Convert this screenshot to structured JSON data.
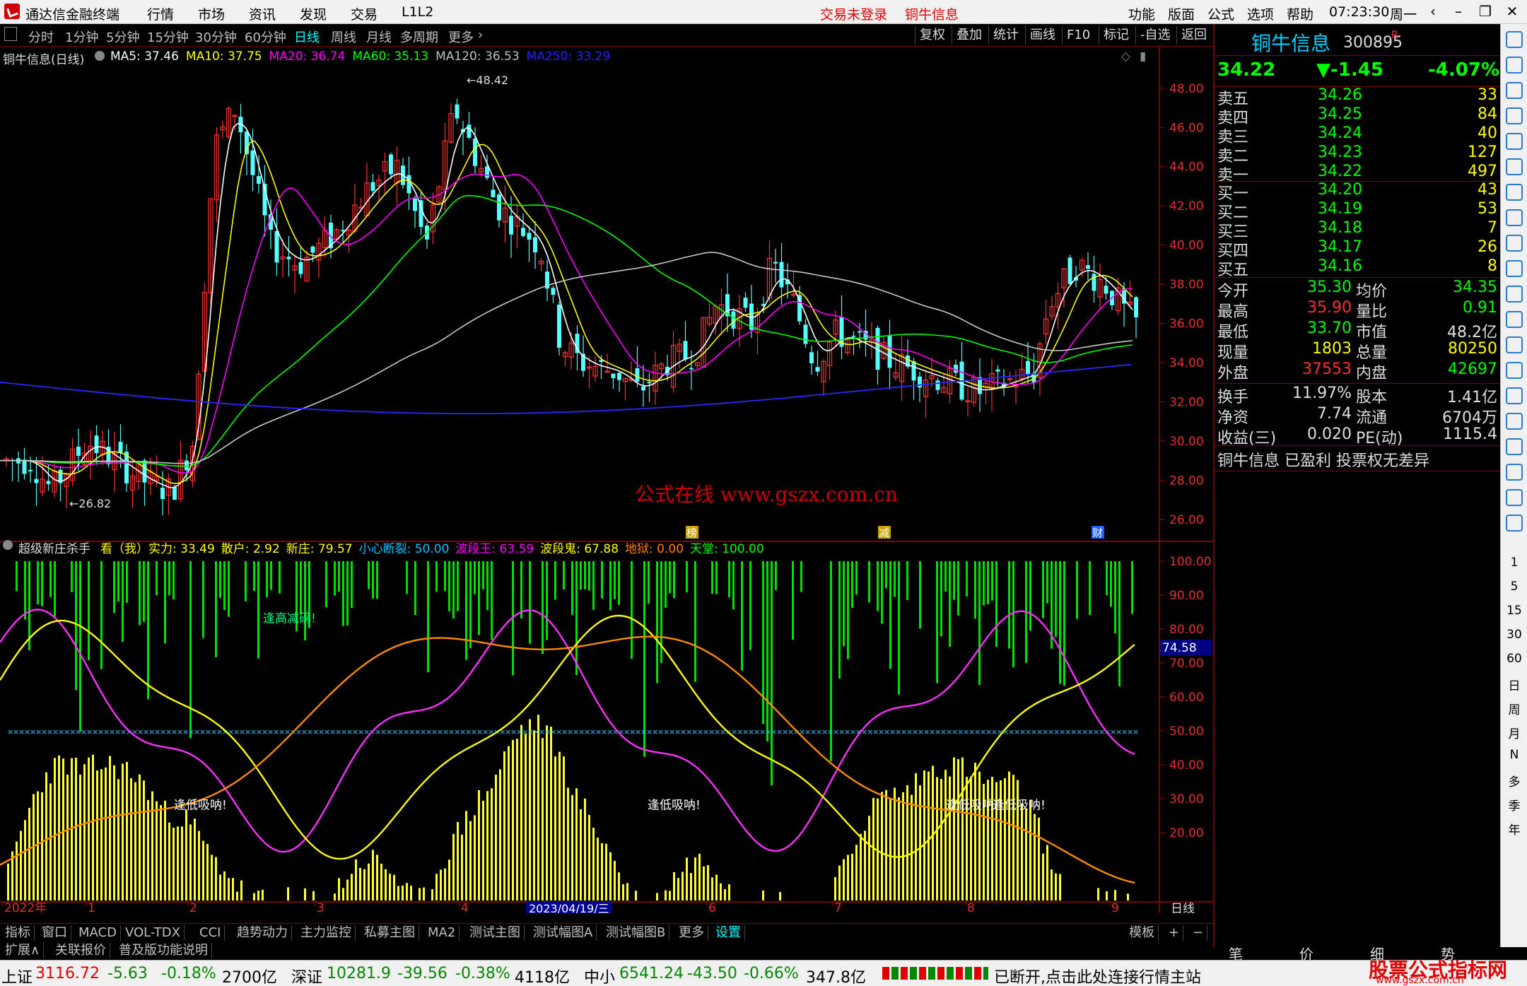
{
  "titlebar": {
    "app_title": "通达信金融终端",
    "menus": [
      "行情",
      "市场",
      "资讯",
      "发现",
      "交易",
      "L1L2"
    ],
    "login_status": "交易未登录",
    "stock_tag": "铜牛信息",
    "right_menus": [
      "功能",
      "版面",
      "公式",
      "选项",
      "帮助"
    ],
    "clock": "07:23:30",
    "weekday": "周一"
  },
  "toolbar": {
    "periods": [
      "分时",
      "1分钟",
      "5分钟",
      "15分钟",
      "30分钟",
      "60分钟",
      "日线",
      "周线",
      "月线",
      "多周期",
      "更多"
    ],
    "active_period": "日线",
    "right_buttons": [
      "复权",
      "叠加",
      "统计",
      "画线",
      "F10",
      "标记",
      "-自选",
      "返回"
    ]
  },
  "main_chart": {
    "title": "铜牛信息(日线)",
    "ma": [
      {
        "label": "MA5: 37.46",
        "color": "#ffffff"
      },
      {
        "label": "MA10: 37.75",
        "color": "#ffff00"
      },
      {
        "label": "MA20: 36.74",
        "color": "#ff00ff"
      },
      {
        "label": "MA60: 35.13",
        "color": "#00ff00"
      },
      {
        "label": "MA120: 36.53",
        "color": "#c0c0c0"
      },
      {
        "label": "MA250: 33.29",
        "color": "#2020ff"
      }
    ],
    "y_ticks": [
      "48.00",
      "46.00",
      "44.00",
      "42.00",
      "40.00",
      "38.00",
      "36.00",
      "34.00",
      "32.00",
      "30.00",
      "28.00",
      "26.00"
    ],
    "high_mark": "48.42",
    "low_mark": "26.82",
    "watermark": "公式在线  www.gszx.com.cn",
    "event_markers": [
      "榜",
      "减",
      "财"
    ]
  },
  "indicator": {
    "name": "超级新庄杀手",
    "labels": [
      {
        "text": "看（我）实力: 33.49",
        "color": "#ffff00"
      },
      {
        "text": "散户: 2.92",
        "color": "#ffff00"
      },
      {
        "text": "新庄: 79.57",
        "color": "#ffff00"
      },
      {
        "text": "小心断裂: 50.00",
        "color": "#00c0ff"
      },
      {
        "text": "波段王: 63.59",
        "color": "#ff00ff"
      },
      {
        "text": "波段鬼: 67.88",
        "color": "#ffff00"
      },
      {
        "text": "地狱: 0.00",
        "color": "#ff8000"
      },
      {
        "text": "天堂: 100.00",
        "color": "#00ff00"
      }
    ],
    "y_ticks": [
      "100.00",
      "90.00",
      "80.00",
      "70.00",
      "60.00",
      "50.00",
      "40.00",
      "30.00",
      "20.00"
    ],
    "current_value": "74.58",
    "annotations": [
      "逢高减磅!",
      "逢低吸呐!",
      "逢低吸呐!",
      "逢低吸呐!",
      "逢低吸呐!"
    ]
  },
  "x_axis": {
    "labels": [
      "2022年",
      "1",
      "2",
      "3",
      "4",
      "5",
      "6",
      "7",
      "8",
      "9"
    ],
    "cursor_date": "2023/04/19/三",
    "period": "日线"
  },
  "tabs_row1": [
    "指标",
    "窗口",
    "MACD",
    "VOL-TDX",
    "CCI",
    "趋势动力",
    "主力监控",
    "私募主图",
    "MA2",
    "测试主图",
    "测试幅图A",
    "测试幅图B",
    "更多",
    "设置"
  ],
  "tabs_row1_right": [
    "模板",
    "+",
    "−"
  ],
  "tabs_row2": [
    "扩展∧",
    "关联报价",
    "普及版功能说明"
  ],
  "quote_panel": {
    "name": "铜牛信息",
    "code": "300895",
    "tag": "R",
    "price": "34.22",
    "change": "▼-1.45",
    "change_pct": "-4.07%",
    "asks": [
      {
        "label": "卖五",
        "price": "34.26",
        "vol": "33"
      },
      {
        "label": "卖四",
        "price": "34.25",
        "vol": "84"
      },
      {
        "label": "卖三",
        "price": "34.24",
        "vol": "40"
      },
      {
        "label": "卖二",
        "price": "34.23",
        "vol": "127"
      },
      {
        "label": "卖一",
        "price": "34.22",
        "vol": "497"
      }
    ],
    "bids": [
      {
        "label": "买一",
        "price": "34.20",
        "vol": "43"
      },
      {
        "label": "买二",
        "price": "34.19",
        "vol": "53"
      },
      {
        "label": "买三",
        "price": "34.18",
        "vol": "7"
      },
      {
        "label": "买四",
        "price": "34.17",
        "vol": "26"
      },
      {
        "label": "买五",
        "price": "34.16",
        "vol": "8"
      }
    ],
    "stats": [
      {
        "k1": "今开",
        "v1": "35.30",
        "c1": "#00ff00",
        "k2": "均价",
        "v2": "34.35",
        "c2": "#00ff00"
      },
      {
        "k1": "最高",
        "v1": "35.90",
        "c1": "#ff3030",
        "k2": "量比",
        "v2": "0.91",
        "c2": "#00ff00"
      },
      {
        "k1": "最低",
        "v1": "33.70",
        "c1": "#00ff00",
        "k2": "市值",
        "v2": "48.2亿",
        "c2": "#e0e0e0"
      },
      {
        "k1": "现量",
        "v1": "1803",
        "c1": "#ffff00",
        "k2": "总量",
        "v2": "80250",
        "c2": "#ffff00"
      },
      {
        "k1": "外盘",
        "v1": "37553",
        "c1": "#ff3030",
        "k2": "内盘",
        "v2": "42697",
        "c2": "#00ff00"
      }
    ],
    "stats2": [
      {
        "k1": "换手",
        "v1": "11.97%",
        "k2": "股本",
        "v2": "1.41亿"
      },
      {
        "k1": "净资",
        "v1": "7.74",
        "k2": "流通",
        "v2": "6704万"
      },
      {
        "k1": "收益(三)",
        "v1": "0.020",
        "k2": "PE(动)",
        "v2": "1115.4"
      }
    ],
    "note": "铜牛信息 已盈利 投票权无差异",
    "bottom_tabs": [
      "笔",
      "价",
      "细",
      "势"
    ]
  },
  "icon_strip": [
    "1",
    "5",
    "15",
    "30",
    "60",
    "日",
    "周",
    "月",
    "N",
    "多",
    "季",
    "年"
  ],
  "statusbar": {
    "indices": [
      {
        "name": "上证",
        "value": "3116.72",
        "chg": "-5.63",
        "pct": "-0.18%",
        "amt": "2700亿"
      },
      {
        "name": "深证",
        "value": "10281.9",
        "chg": "-39.56",
        "pct": "-0.38%",
        "amt": "4118亿"
      },
      {
        "name": "中小",
        "value": "6541.24",
        "chg": "-43.50",
        "pct": "-0.66%",
        "amt": "347.8亿"
      }
    ],
    "connection": "已断开,点击此处连接行情主站",
    "brand": "股票公式指标网",
    "brand_url": "www.gszx.com.cn"
  }
}
